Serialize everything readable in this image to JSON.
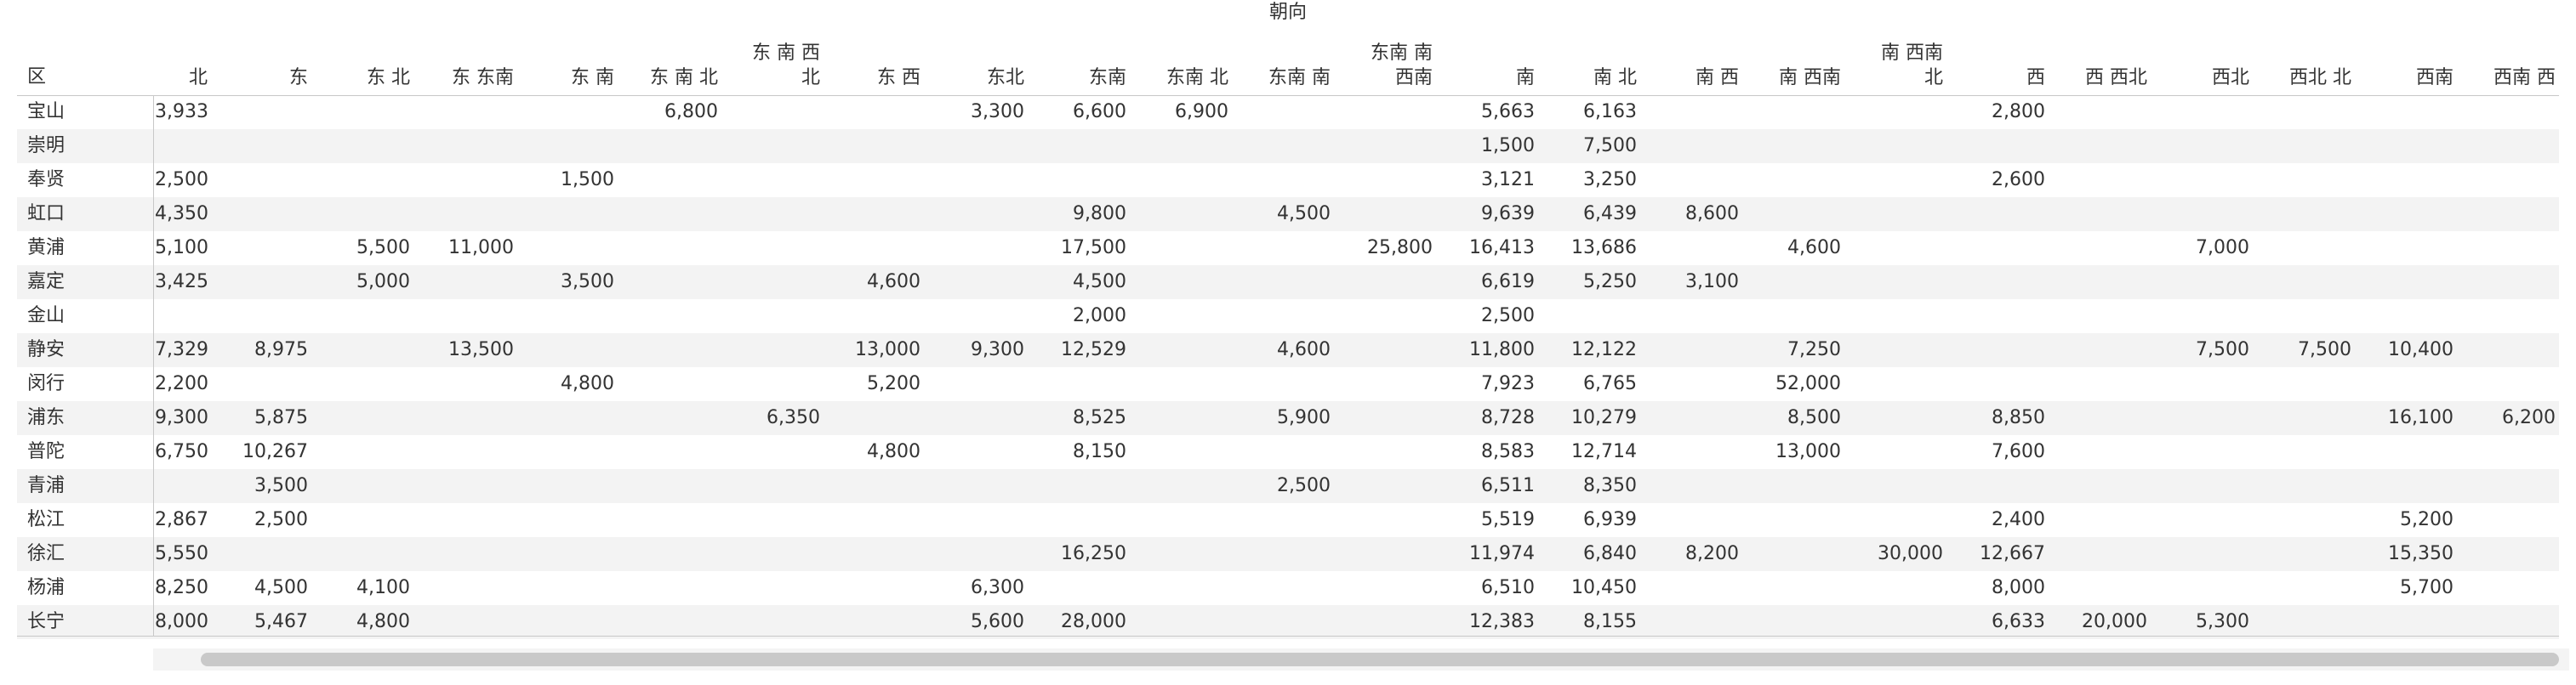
{
  "chart_data": {
    "type": "table",
    "title": "朝向",
    "row_header_label": "区",
    "columns": [
      "北",
      "东",
      "东 北",
      "东 东南",
      "东 南",
      "东 南 北",
      "东 南 西 北",
      "东 西",
      "东北",
      "东南",
      "东南 北",
      "东南 南",
      "东南 南 西南",
      "南",
      "南 北",
      "南 西",
      "南 西南",
      "南 西南 北",
      "西",
      "西 西北",
      "西北",
      "西北 北",
      "西南",
      "西南 西"
    ],
    "rows": [
      {
        "label": "宝山",
        "values": [
          "3,933",
          "",
          "",
          "",
          "",
          "6,800",
          "",
          "",
          "3,300",
          "6,600",
          "6,900",
          "",
          "",
          "5,663",
          "6,163",
          "",
          "",
          "",
          "2,800",
          "",
          "",
          "",
          "",
          ""
        ]
      },
      {
        "label": "崇明",
        "values": [
          "",
          "",
          "",
          "",
          "",
          "",
          "",
          "",
          "",
          "",
          "",
          "",
          "",
          "1,500",
          "7,500",
          "",
          "",
          "",
          "",
          "",
          "",
          "",
          "",
          ""
        ]
      },
      {
        "label": "奉贤",
        "values": [
          "2,500",
          "",
          "",
          "",
          "1,500",
          "",
          "",
          "",
          "",
          "",
          "",
          "",
          "",
          "3,121",
          "3,250",
          "",
          "",
          "",
          "2,600",
          "",
          "",
          "",
          "",
          ""
        ]
      },
      {
        "label": "虹口",
        "values": [
          "4,350",
          "",
          "",
          "",
          "",
          "",
          "",
          "",
          "",
          "9,800",
          "",
          "4,500",
          "",
          "9,639",
          "6,439",
          "8,600",
          "",
          "",
          "",
          "",
          "",
          "",
          "",
          ""
        ]
      },
      {
        "label": "黄浦",
        "values": [
          "5,100",
          "",
          "5,500",
          "11,000",
          "",
          "",
          "",
          "",
          "",
          "17,500",
          "",
          "",
          "25,800",
          "16,413",
          "13,686",
          "",
          "4,600",
          "",
          "",
          "",
          "7,000",
          "",
          "",
          ""
        ]
      },
      {
        "label": "嘉定",
        "values": [
          "3,425",
          "",
          "5,000",
          "",
          "3,500",
          "",
          "",
          "4,600",
          "",
          "4,500",
          "",
          "",
          "",
          "6,619",
          "5,250",
          "3,100",
          "",
          "",
          "",
          "",
          "",
          "",
          "",
          ""
        ]
      },
      {
        "label": "金山",
        "values": [
          "",
          "",
          "",
          "",
          "",
          "",
          "",
          "",
          "",
          "2,000",
          "",
          "",
          "",
          "2,500",
          "",
          "",
          "",
          "",
          "",
          "",
          "",
          "",
          "",
          ""
        ]
      },
      {
        "label": "静安",
        "values": [
          "7,329",
          "8,975",
          "",
          "13,500",
          "",
          "",
          "",
          "13,000",
          "9,300",
          "12,529",
          "",
          "4,600",
          "",
          "11,800",
          "12,122",
          "",
          "7,250",
          "",
          "",
          "",
          "7,500",
          "7,500",
          "10,400",
          ""
        ]
      },
      {
        "label": "闵行",
        "values": [
          "2,200",
          "",
          "",
          "",
          "4,800",
          "",
          "",
          "5,200",
          "",
          "",
          "",
          "",
          "",
          "7,923",
          "6,765",
          "",
          "52,000",
          "",
          "",
          "",
          "",
          "",
          "",
          ""
        ]
      },
      {
        "label": "浦东",
        "values": [
          "9,300",
          "5,875",
          "",
          "",
          "",
          "",
          "6,350",
          "",
          "",
          "8,525",
          "",
          "5,900",
          "",
          "8,728",
          "10,279",
          "",
          "8,500",
          "",
          "8,850",
          "",
          "",
          "",
          "16,100",
          "6,200"
        ]
      },
      {
        "label": "普陀",
        "values": [
          "6,750",
          "10,267",
          "",
          "",
          "",
          "",
          "",
          "4,800",
          "",
          "8,150",
          "",
          "",
          "",
          "8,583",
          "12,714",
          "",
          "13,000",
          "",
          "7,600",
          "",
          "",
          "",
          "",
          ""
        ]
      },
      {
        "label": "青浦",
        "values": [
          "",
          "3,500",
          "",
          "",
          "",
          "",
          "",
          "",
          "",
          "",
          "",
          "2,500",
          "",
          "6,511",
          "8,350",
          "",
          "",
          "",
          "",
          "",
          "",
          "",
          "",
          ""
        ]
      },
      {
        "label": "松江",
        "values": [
          "2,867",
          "2,500",
          "",
          "",
          "",
          "",
          "",
          "",
          "",
          "",
          "",
          "",
          "",
          "5,519",
          "6,939",
          "",
          "",
          "",
          "2,400",
          "",
          "",
          "",
          "5,200",
          ""
        ]
      },
      {
        "label": "徐汇",
        "values": [
          "5,550",
          "",
          "",
          "",
          "",
          "",
          "",
          "",
          "",
          "16,250",
          "",
          "",
          "",
          "11,974",
          "6,840",
          "8,200",
          "",
          "30,000",
          "12,667",
          "",
          "",
          "",
          "15,350",
          ""
        ]
      },
      {
        "label": "杨浦",
        "values": [
          "8,250",
          "4,500",
          "4,100",
          "",
          "",
          "",
          "",
          "",
          "6,300",
          "",
          "",
          "",
          "",
          "6,510",
          "10,450",
          "",
          "",
          "",
          "8,000",
          "",
          "",
          "",
          "5,700",
          ""
        ]
      },
      {
        "label": "长宁",
        "values": [
          "8,000",
          "5,467",
          "4,800",
          "",
          "",
          "",
          "",
          "",
          "5,600",
          "28,000",
          "",
          "",
          "",
          "12,383",
          "8,155",
          "",
          "",
          "",
          "6,633",
          "20,000",
          "5,300",
          "",
          "",
          ""
        ]
      }
    ],
    "grid": false,
    "colors": {
      "text": "#333333",
      "band": "#f3f3f3",
      "rule": "#c8c8c8",
      "scroll_thumb": "#c9c9c9"
    }
  }
}
